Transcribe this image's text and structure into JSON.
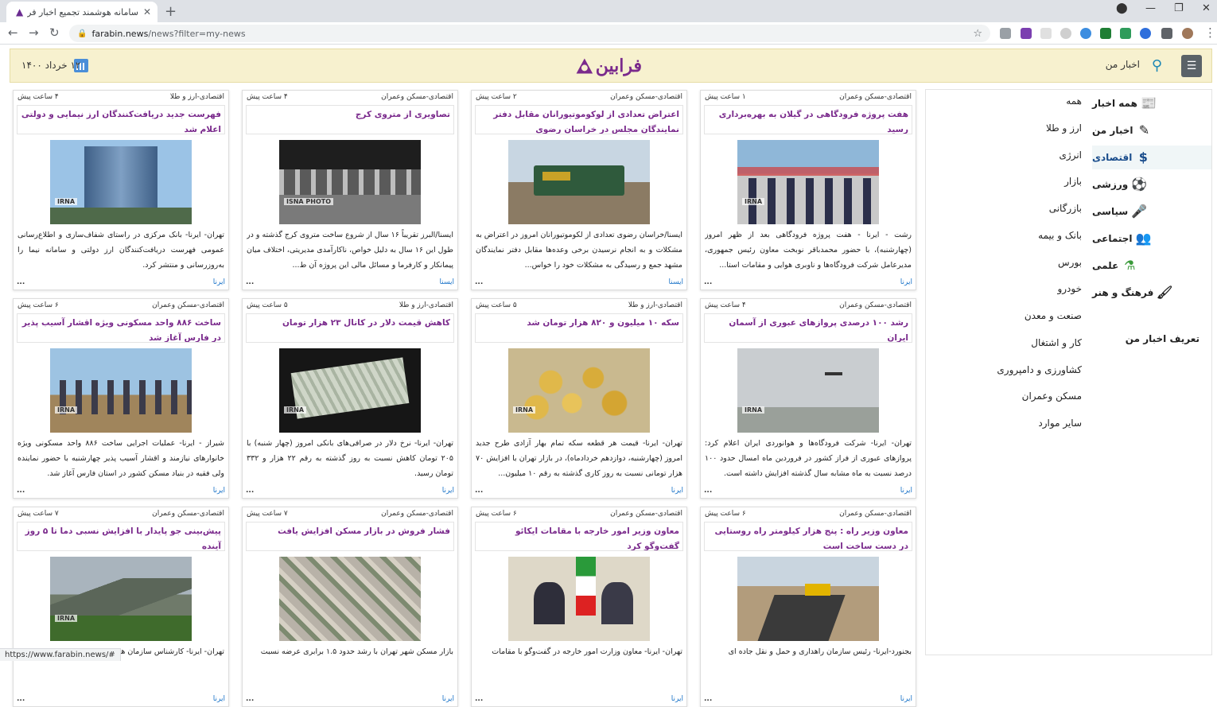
{
  "browser": {
    "tab_title": "سامانه هوشمند تجمیع اخبار فرابین",
    "url_host": "farabin.news",
    "url_path": "/news?filter=my-news",
    "status_url": "https://www.farabin.news/#"
  },
  "header": {
    "my_news_label": "اخبار من",
    "logo_text": "فرابین",
    "date": "۱۲ خرداد ۱۴۰۰"
  },
  "sidebar": {
    "categories": [
      {
        "label": "همه اخبار",
        "icon": "newspaper-icon"
      },
      {
        "label": "اخبار من",
        "icon": "pencil-paper-icon"
      },
      {
        "label": "اقتصادی",
        "icon": "money-chart-icon"
      },
      {
        "label": "ورزشی",
        "icon": "ball-icon"
      },
      {
        "label": "سیاسی",
        "icon": "microphone-icon"
      },
      {
        "label": "اجتماعی",
        "icon": "people-icon"
      },
      {
        "label": "علمی",
        "icon": "flask-icon"
      },
      {
        "label": "فرهنگ و هنر",
        "icon": "brush-icon"
      }
    ],
    "subcategories": [
      "همه",
      "ارز و طلا",
      "انرژی",
      "بازار",
      "بازرگانی",
      "بانک و بیمه",
      "بورس",
      "خودرو",
      "صنعت و معدن",
      "کار و اشتغال",
      "کشاورزی و دامپروری",
      "مسکن وعمران",
      "سایر موارد"
    ],
    "define_label": "تعریف اخبار من"
  },
  "cards": [
    {
      "category": "اقتصادی-مسکن وعمران",
      "time": "۱ ساعت پیش",
      "title": "هفت پروژه فرودگاهی در گیلان به بهره‌برداری رسید",
      "summary": "رشت - ایرنا - هفت پروژه فرودگاهی بعد از ظهر امروز (چهارشنبه)، با حضور محمدباقر نوبخت معاون رئیس جمهوری، مدیرعامل شرکت فرودگاه‌ها و ناوبری هوایی و مقامات استا...",
      "source": "ایرنا",
      "img_tag": "IRNA"
    },
    {
      "category": "اقتصادی-مسکن وعمران",
      "time": "۲ ساعت پیش",
      "title": "اعتراض تعدادی از لوکوموتیورانان مقابل دفتر نمایندگان مجلس در خراسان رضوی",
      "summary": "ایسنا/خراسان رضوی تعدادی از لکوموتیورانان امروز در اعتراض به مشکلات و به انجام نرسیدن برخی وعده‌ها مقابل دفتر نمایندگان مشهد جمع و رسیدگی به مشکلات خود را خواس...",
      "source": "ایسنا",
      "img_tag": ""
    },
    {
      "category": "اقتصادی-مسکن وعمران",
      "time": "۴ ساعت پیش",
      "title": "تصاویری از متروی کرج",
      "summary": "ایسنا/البرز تقریباً ۱۶ سال از شروع ساخت متروی کرج گذشته و در طول این ۱۶ سال به دلیل خواص، ناکارآمدی مدیریتی، اختلاف میان پیمانکار و کارفرما و مسائل مالی این پروژه آن ط...",
      "source": "ایسنا",
      "img_tag": "ISNA PHOTO"
    },
    {
      "category": "اقتصادی-ارز و طلا",
      "time": "۴ ساعت پیش",
      "title": "فهرست جدید دریافت‌کنندگان ارز نیمایی و دولتی اعلام شد",
      "summary": "تهران- ایرنا- بانک مرکزی در راستای شفاف‌سازی و اطلاع‌رسانی عمومی فهرست دریافت‌کنندگان ارز دولتی و سامانه نیما را به‌روزرسانی و منتشر کرد.",
      "source": "ایرنا",
      "img_tag": "IRNA"
    },
    {
      "category": "اقتصادی-مسکن وعمران",
      "time": "۴ ساعت پیش",
      "title": "رشد ۱۰۰ درصدی پروازهای عبوری از آسمان ایران",
      "summary": "تهران- ایرنا- شرکت فرودگاه‌ها و هوانوردی ایران اعلام کرد: پروازهای عبوری از فراز کشور در فروردین ماه امسال حدود ۱۰۰ درصد نسبت به ماه مشابه سال گذشته افزایش داشته است.",
      "source": "ایرنا",
      "img_tag": "IRNA"
    },
    {
      "category": "اقتصادی-ارز و طلا",
      "time": "۵ ساعت پیش",
      "title": "سکه ۱۰ میلیون و ۸۲۰ هزار تومان شد",
      "summary": "تهران- ایرنا- قیمت هر قطعه سکه تمام بهار آزادی طرح جدید امروز (چهارشنبه، دوازدهم خردادماه)، در بازار تهران با افزایش ۷۰ هزار تومانی نسبت به روز کاری گذشته به رقم ۱۰ میلیون...",
      "source": "ایرنا",
      "img_tag": "IRNA"
    },
    {
      "category": "اقتصادی-ارز و طلا",
      "time": "۵ ساعت پیش",
      "title": "کاهش قیمت دلار در کانال ۲۳ هزار تومان",
      "summary": "تهران- ایرنا- نرخ دلار در صرافی‌های بانکی امروز (چهار شنبه) با ۲۰۵ تومان کاهش نسبت به روز گذشته به رقم ۲۲ هزار و ۳۳۲ تومان رسید.",
      "source": "ایرنا",
      "img_tag": "IRNA"
    },
    {
      "category": "اقتصادی-مسکن وعمران",
      "time": "۶ ساعت پیش",
      "title": "ساخت ۸۸۶ واحد مسکونی ویژه اقشار آسیب پذیر در فارس آغاز شد",
      "summary": "شیراز - ایرنا- عملیات اجرایی ساخت ۸۸۶ واحد مسکونی ویژه خانوارهای نیازمند و اقشار آسیب پذیر چهارشنبه با حضور نماینده ولی فقیه در بنیاد مسکن کشور در استان فارس آغاز شد.",
      "source": "ایرنا",
      "img_tag": "IRNA"
    },
    {
      "category": "اقتصادی-مسکن وعمران",
      "time": "۶ ساعت پیش",
      "title": "معاون وزیر راه : پنج هزار کیلومتر راه روستایی در دست ساخت است",
      "summary": "بجنورد-ایرنا- رئیس سازمان راهداری و حمل و نقل جاده ای",
      "source": "ایرنا",
      "img_tag": ""
    },
    {
      "category": "اقتصادی-مسکن وعمران",
      "time": "۶ ساعت پیش",
      "title": "معاون وزیر امور خارجه با مقامات ایکائو گفت‌وگو کرد",
      "summary": "تهران- ایرنا- معاون وزارت امور خارجه در گفت‌وگو با مقامات",
      "source": "ایرنا",
      "img_tag": ""
    },
    {
      "category": "اقتصادی-مسکن وعمران",
      "time": "۷ ساعت پیش",
      "title": "فشار فروش در بازار مسکن افزایش یافت",
      "summary": "بازار مسکن شهر تهران با رشد حدود ۱.۵ برابری عرضه نسبت",
      "source": "ایرنا",
      "img_tag": ""
    },
    {
      "category": "اقتصادی-مسکن وعمران",
      "time": "۷ ساعت پیش",
      "title": "پیش‌بینی جو پایدار با افزایش نسبی دما تا ۵ روز آینده",
      "summary": "تهران- ایرنا- کارشناس سازمان هواشناسی",
      "source": "ایرنا",
      "img_tag": "IRNA"
    }
  ]
}
